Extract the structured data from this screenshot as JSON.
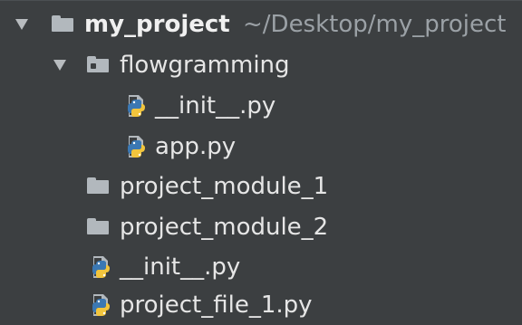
{
  "tree": {
    "root": {
      "name": "my_project",
      "path": "~/Desktop/my_project",
      "icon": "folder-icon",
      "expanded": true
    },
    "children": [
      {
        "name": "flowgramming",
        "icon": "package-folder-icon",
        "expanded": true,
        "children": [
          {
            "name": "__init__.py",
            "icon": "python-file-icon"
          },
          {
            "name": "app.py",
            "icon": "python-file-icon"
          }
        ]
      },
      {
        "name": "project_module_1",
        "icon": "folder-icon"
      },
      {
        "name": "project_module_2",
        "icon": "folder-icon"
      },
      {
        "name": "__init__.py",
        "icon": "python-file-icon"
      },
      {
        "name": "project_file_1.py",
        "icon": "python-file-icon"
      }
    ]
  },
  "colors": {
    "background": "#3c3f41",
    "text": "#e6e6e6",
    "path_text": "#9ba1a6",
    "folder": "#b2b8bd",
    "python_blue": "#3b78b3",
    "python_yellow": "#f2c53d"
  }
}
